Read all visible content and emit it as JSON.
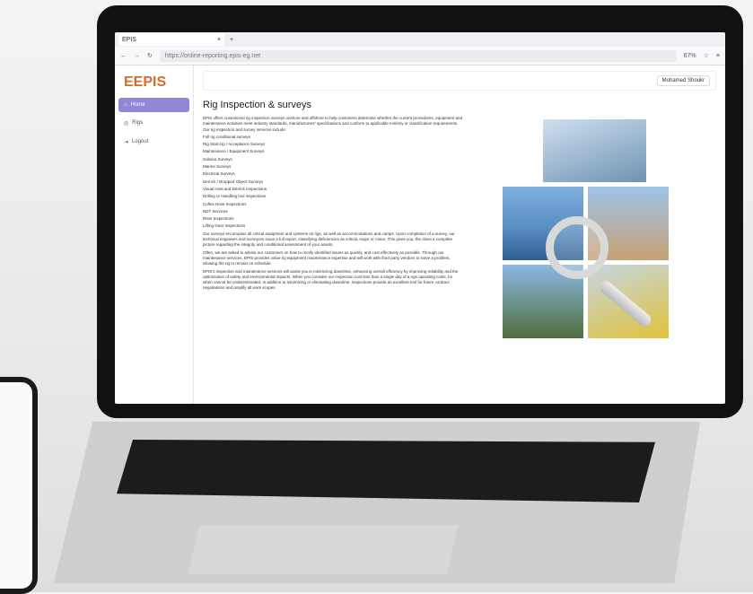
{
  "browser": {
    "tab_title": "EPIS",
    "url": "https://online-reporting.epis-eg.net",
    "zoom": "67%"
  },
  "sidebar": {
    "logo": "EPIS",
    "items": [
      {
        "label": "Home"
      },
      {
        "label": "Rigs"
      },
      {
        "label": "Logout"
      }
    ]
  },
  "header": {
    "user": "Mohamed Shoukr"
  },
  "main": {
    "title": "Rig Inspection & surveys",
    "paragraphs": [
      "EPIS offers customized rig inspection surveys onshore and offshore to help customers determine whether the current procedures, equipment and maintenance activities meet industry standards, manufacturers' specifications and conform to applicable ministry or classification requirements. Our rig inspection and survey services include:",
      "Full rig conditional surveys",
      "Rig Start-Up / Acceptance Surveys",
      "Maintenance / Equipment Surveys",
      "Subsea Surveys",
      "Marine Surveys",
      "Electrical Surveys",
      "Derrick / Dropped Object Surveys",
      "Visual Host and Derrick Inspections",
      "Drilling or Handling tool inspections",
      "Coflex Hose Inspections",
      "NDT Services",
      "Riser Inspections",
      "Lifting Gear Inspections",
      "Our surveys encompass all critical equipment and systems on rigs, as well as accommodations and camps. Upon completion of a survey, our technical engineers and surveyors issue a full report, classifying deficiencies as critical, major or minor. This gives you, the client a complete picture regarding the integrity and conditional assessment of your assets.",
      "Often, we are asked to advise our customers on how to rectify identified issues as quickly, and cost effectively as possible. Through our maintenance services, EPIS provides value rig equipment maintenance expertise and will work with third party vendors to solve a problem, allowing the rig to remain on schedule.",
      "EPIS's inspection and maintenance services will assist you in minimizing downtime, enhancing overall efficiency by improving reliability and the optimization of safety and environmental impacts. When you consider our inspection cost less than a single day of a rigs operating costs, for when cannot be underestimated. In addition to minimizing or eliminating downtime, inspections provide an excellent tool for future contract negotiations and amplify all work scopes."
    ]
  },
  "colors": {
    "accent": "#8e88d8",
    "logo_primary": "#7a3a8c",
    "logo_secondary": "#d66b2b"
  }
}
